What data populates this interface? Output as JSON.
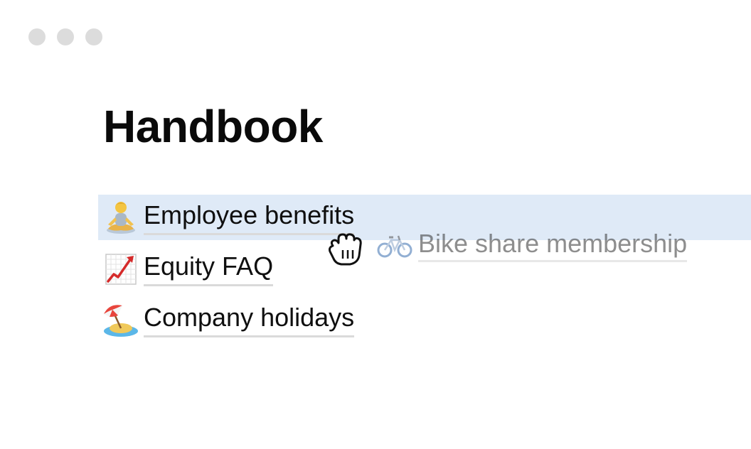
{
  "window": {
    "controls": [
      "close",
      "minimize",
      "maximize"
    ],
    "control_color": "#dcdcdc"
  },
  "page": {
    "title": "Handbook"
  },
  "items": [
    {
      "icon": "person-meditating-icon",
      "label": "Employee benefits",
      "selected": true
    },
    {
      "icon": "chart-increasing-icon",
      "label": "Equity FAQ",
      "selected": false
    },
    {
      "icon": "beach-umbrella-icon",
      "label": "Company holidays",
      "selected": false
    }
  ],
  "dragging": {
    "icon": "bicycle-icon",
    "label": "Bike share membership"
  },
  "cursor": "grab-cursor",
  "colors": {
    "selection": "#dfeaf7",
    "underline": "#dadada",
    "text": "#0f0f0f"
  }
}
